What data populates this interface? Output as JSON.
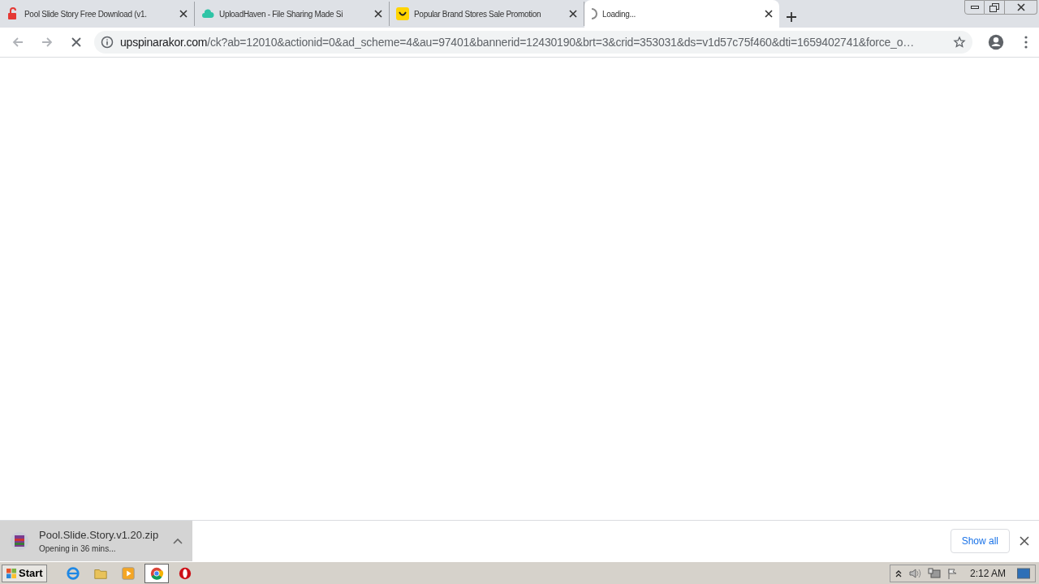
{
  "tabs": [
    {
      "kind": "lock",
      "title": "Pool Slide Story Free Download (v1.",
      "selected": false
    },
    {
      "kind": "cloud",
      "title": "UploadHaven - File Sharing Made Si",
      "selected": false
    },
    {
      "kind": "smile",
      "title": "Popular Brand Stores Sale Promotion",
      "selected": false
    },
    {
      "kind": "spinner",
      "title": "Loading...",
      "selected": true
    }
  ],
  "address_bar": {
    "host": "upspinarakor.com",
    "path": "/ck?ab=12010&actionid=0&ad_scheme=4&au=97401&bannerid=12430190&brt=3&crid=353031&ds=v1d57c75f460&dti=1659402741&force_o…"
  },
  "download_bar": {
    "file_name": "Pool.Slide.Story.v1.20.zip",
    "status": "Opening in 36 mins...",
    "show_all": "Show all"
  },
  "taskbar": {
    "start": "Start",
    "apps": [
      {
        "kind": "ie",
        "selected": false
      },
      {
        "kind": "folder",
        "selected": false
      },
      {
        "kind": "media",
        "selected": false
      },
      {
        "kind": "chrome",
        "selected": true
      },
      {
        "kind": "opera",
        "selected": false
      }
    ],
    "clock": "2:12 AM"
  }
}
